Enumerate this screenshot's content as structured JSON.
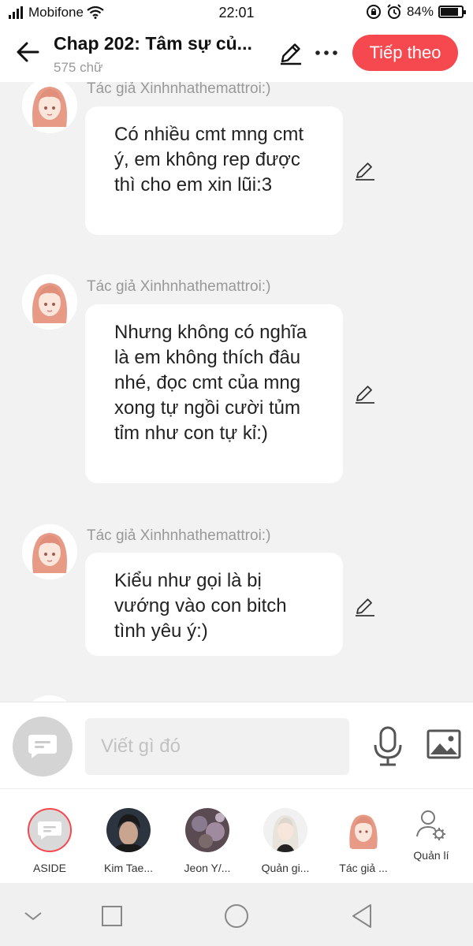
{
  "status_bar": {
    "carrier": "Mobifone",
    "time": "22:01",
    "battery": "84%",
    "battery_level": 0.84
  },
  "header": {
    "title": "Chap 202: Tâm sự củ...",
    "word_count": "575 chữ",
    "next_label": "Tiếp theo"
  },
  "messages": [
    {
      "author": "Tác giả Xinhnhathemattroi:)",
      "text": "Có nhiều cmt mng cmt ý, em không rep được thì cho em xin lũi:3"
    },
    {
      "author": "Tác giả Xinhnhathemattroi:)",
      "text": "Nhưng không có nghĩa là em không thích đâu nhé, đọc cmt của mng xong tự ngồi cười tủm tỉm như con tự kỉ:)"
    },
    {
      "author": "Tác giả Xinhnhathemattroi:)",
      "text": "Kiểu như gọi là bị vướng vào con bitch tình yêu ý:)"
    }
  ],
  "input": {
    "placeholder": "Viết gì đó"
  },
  "characters": [
    {
      "label": "ASIDE"
    },
    {
      "label": "Kim Tae..."
    },
    {
      "label": "Jeon Y/..."
    },
    {
      "label": "Quản gi..."
    },
    {
      "label": "Tác giả ..."
    },
    {
      "label": "Quản lí"
    }
  ],
  "colors": {
    "accent": "#f5484f",
    "background": "#f2f2f2",
    "bubble": "#ffffff",
    "muted_text": "#999999"
  },
  "icons": {
    "back": "arrow-left-icon",
    "edit": "pencil-icon",
    "more": "more-dots-icon",
    "mic": "microphone-icon",
    "image": "image-icon",
    "aside": "chat-bubble-icon",
    "manage": "user-gear-icon"
  }
}
